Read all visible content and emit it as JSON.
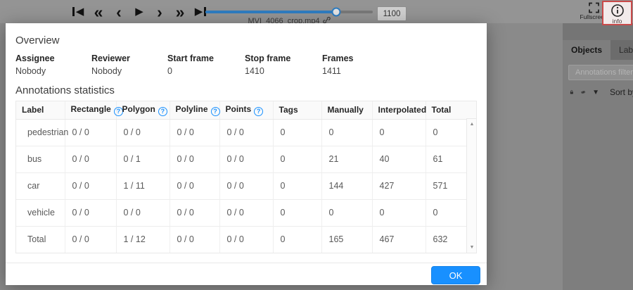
{
  "player": {
    "controls": [
      {
        "name": "first-frame",
        "glyph": "◀"
      },
      {
        "name": "backward",
        "glyph": "«"
      },
      {
        "name": "previous",
        "glyph": "‹"
      },
      {
        "name": "play",
        "glyph": "▶"
      },
      {
        "name": "next",
        "glyph": "›"
      },
      {
        "name": "forward",
        "glyph": "»"
      },
      {
        "name": "last-frame",
        "glyph": "▶"
      }
    ],
    "filename": "MVI_4066_crop.mp4",
    "frame_value": "1100",
    "progress_percent": 78
  },
  "topbar_right": {
    "fullscreen_label": "Fullscreen",
    "info_label": "info"
  },
  "modal": {
    "overview_title": "Overview",
    "fields": [
      {
        "label": "Assignee",
        "value": "Nobody"
      },
      {
        "label": "Reviewer",
        "value": "Nobody"
      },
      {
        "label": "Start frame",
        "value": "0"
      },
      {
        "label": "Stop frame",
        "value": "1410"
      },
      {
        "label": "Frames",
        "value": "1411"
      }
    ],
    "stats_title": "Annotations statistics",
    "table": {
      "help_glyph": "?",
      "scroll_up_glyph": "▲",
      "scroll_down_glyph": "▼",
      "columns": [
        {
          "label": "Label"
        },
        {
          "label": "Rectangle",
          "help": true
        },
        {
          "label": "Polygon",
          "help": true
        },
        {
          "label": "Polyline",
          "help": true
        },
        {
          "label": "Points",
          "help": true
        },
        {
          "label": "Tags"
        },
        {
          "label": "Manually"
        },
        {
          "label": "Interpolated"
        },
        {
          "label": "Total"
        }
      ],
      "rows": [
        {
          "label": "pedestrian",
          "cells": [
            "0 / 0",
            "0 / 0",
            "0 / 0",
            "0 / 0",
            "0",
            "0",
            "0",
            "0"
          ]
        },
        {
          "label": "bus",
          "cells": [
            "0 / 0",
            "0 / 1",
            "0 / 0",
            "0 / 0",
            "0",
            "21",
            "40",
            "61"
          ]
        },
        {
          "label": "car",
          "cells": [
            "0 / 0",
            "1 / 11",
            "0 / 0",
            "0 / 0",
            "0",
            "144",
            "427",
            "571"
          ]
        },
        {
          "label": "vehicle",
          "cells": [
            "0 / 0",
            "0 / 0",
            "0 / 0",
            "0 / 0",
            "0",
            "0",
            "0",
            "0"
          ]
        },
        {
          "label": "Total",
          "cells": [
            "0 / 0",
            "1 / 12",
            "0 / 0",
            "0 / 0",
            "0",
            "165",
            "467",
            "632"
          ]
        }
      ]
    },
    "ok_label": "OK"
  },
  "sidebar": {
    "tabs": [
      {
        "label": "Objects"
      },
      {
        "label": "Labels"
      }
    ],
    "filter_placeholder": "Annotations filter",
    "sort_label": "Sort by",
    "caret_glyph": "▼"
  },
  "colors": {
    "accent": "#1890ff",
    "info_active_border": "#c94a4a",
    "slider_fill": "#2e7cc0"
  }
}
